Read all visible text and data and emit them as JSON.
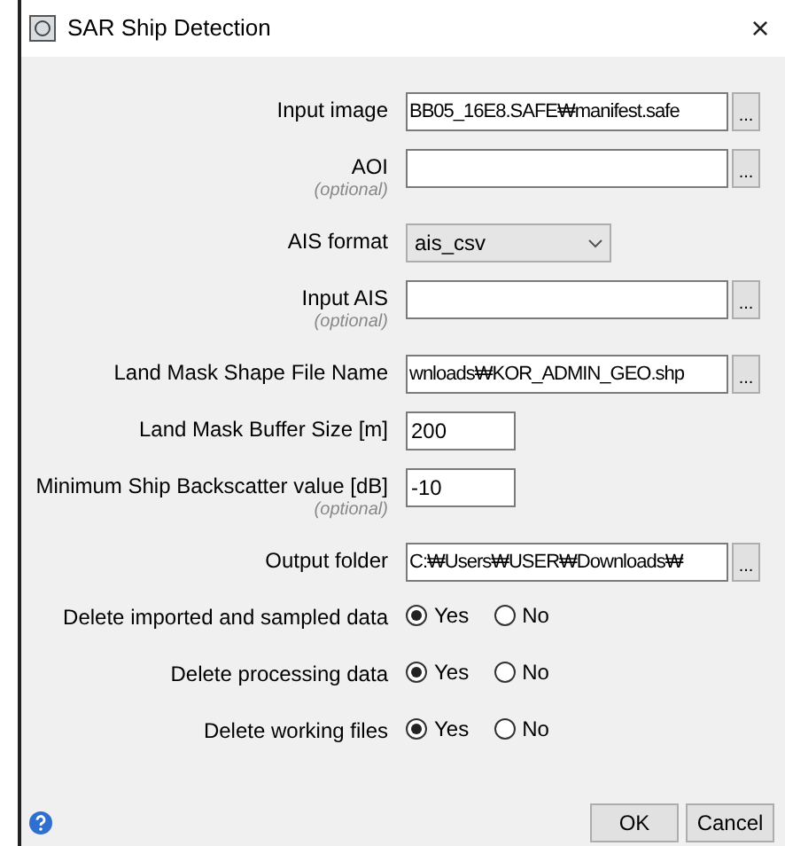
{
  "window": {
    "title": "SAR Ship Detection",
    "close": "×"
  },
  "fields": [
    {
      "kind": "path",
      "label": "Input image",
      "value": "BB05_16E8.SAFE₩manifest.safe",
      "button": "..."
    },
    {
      "kind": "path",
      "label": "AOI",
      "note": "(optional)",
      "button": "..."
    },
    {
      "kind": "select",
      "label": "AIS format",
      "value": "ais_csv"
    },
    {
      "kind": "path",
      "label": "Input AIS",
      "note": "(optional)",
      "button": "..."
    },
    {
      "kind": "path",
      "label": "Land Mask Shape File Name",
      "value": "wnloads₩KOR_ADMIN_GEO.shp",
      "button": "..."
    },
    {
      "kind": "number",
      "label": "Land Mask Buffer Size [m]",
      "value": "200"
    },
    {
      "kind": "number",
      "label": "Minimum Ship Backscatter value [dB]",
      "note": "(optional)",
      "value": "-10"
    },
    {
      "kind": "path",
      "label": "Output folder",
      "value": "C:₩Users₩USER₩Downloads₩",
      "button": "..."
    },
    {
      "kind": "radio",
      "label": "Delete imported and sampled data",
      "options": [
        {
          "label": "Yes",
          "selected": true
        },
        {
          "label": "No",
          "selected": false
        }
      ]
    },
    {
      "kind": "radio",
      "label": "Delete processing data",
      "options": [
        {
          "label": "Yes",
          "selected": true
        },
        {
          "label": "No",
          "selected": false
        }
      ]
    },
    {
      "kind": "radio",
      "label": "Delete working files",
      "options": [
        {
          "label": "Yes",
          "selected": true
        },
        {
          "label": "No",
          "selected": false
        }
      ]
    }
  ],
  "buttons": [
    "OK",
    "Cancel"
  ]
}
